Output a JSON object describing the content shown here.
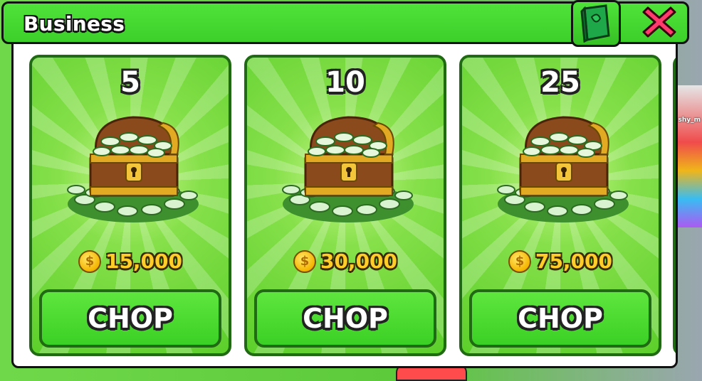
{
  "window": {
    "title": "Business"
  },
  "header": {
    "book_icon": "book-icon",
    "close_icon": "close-icon"
  },
  "background": {
    "player_name": "shy_m"
  },
  "cards": [
    {
      "quantity": "5",
      "price": "15,000",
      "button_label": "CHOP"
    },
    {
      "quantity": "10",
      "price": "30,000",
      "button_label": "CHOP"
    },
    {
      "quantity": "25",
      "price": "75,000",
      "button_label": "CHOP"
    }
  ],
  "colors": {
    "panel_green": "#3dcf2a",
    "card_border": "#1f6a12",
    "coin_gold": "#f5b400",
    "close_red": "#ff3b6e"
  }
}
